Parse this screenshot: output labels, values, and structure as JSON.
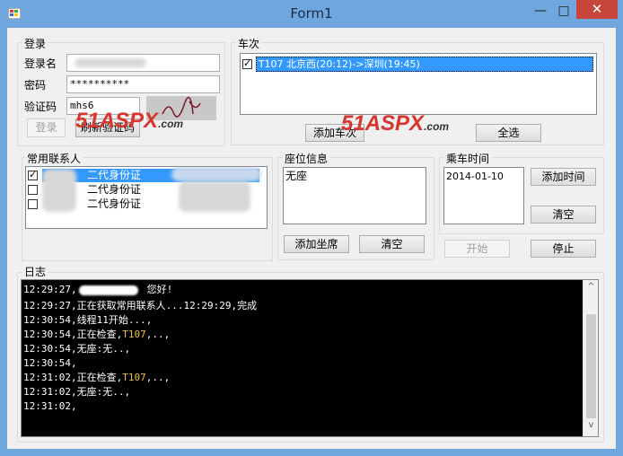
{
  "window": {
    "title": "Form1",
    "minimize_glyph": "—",
    "maximize_glyph": "□",
    "close_glyph": "✕"
  },
  "login": {
    "group_label": "登录",
    "username_label": "登录名",
    "password_label": "密码",
    "password_value": "**********",
    "captcha_label": "验证码",
    "captcha_value": "mhs6",
    "captcha_image_text": "mhs6",
    "login_button": "登录",
    "refresh_captcha_button": "刷新验证码"
  },
  "trains": {
    "group_label": "车次",
    "items": [
      {
        "checked": true,
        "text": "T107 北京西(20:12)->深圳(19:45)"
      }
    ],
    "add_button": "添加车次",
    "select_all_button": "全选"
  },
  "contacts": {
    "group_label": "常用联系人",
    "items": [
      {
        "checked": true,
        "id_type": "二代身份证",
        "selected": true
      },
      {
        "checked": false,
        "id_type": "二代身份证",
        "selected": false
      },
      {
        "checked": false,
        "id_type": "二代身份证",
        "selected": false
      }
    ]
  },
  "seats": {
    "group_label": "座位信息",
    "items": [
      "无座"
    ],
    "add_button": "添加坐席",
    "clear_button": "清空"
  },
  "travel_time": {
    "group_label": "乘车时间",
    "items": [
      "2014-01-10"
    ],
    "add_button": "添加时间",
    "clear_button": "清空"
  },
  "controls": {
    "start_button": "开始",
    "stop_button": "停止"
  },
  "log": {
    "group_label": "日志",
    "lines": [
      {
        "time": "12:29:27,",
        "text": "您好!"
      },
      {
        "time": "12:29:27,",
        "text": "正在获取常用联系人...12:29:29,完成"
      },
      {
        "time": "12:30:54,",
        "text": "线程11开始...,"
      },
      {
        "time": "12:30:54,",
        "text": "正在检查,",
        "highlight": "T107",
        "tail": ",..,"
      },
      {
        "time": "12:30:54,",
        "text": "无座:无..,"
      },
      {
        "time": "12:30:54,",
        "text": ""
      },
      {
        "time": "12:31:02,",
        "text": "正在检查,",
        "highlight": "T107",
        "tail": ",..,"
      },
      {
        "time": "12:31:02,",
        "text": "无座:无..,"
      },
      {
        "time": "12:31:02,",
        "text": ""
      }
    ],
    "scroll_up": "^",
    "scroll_down": "v"
  },
  "watermark": {
    "text": "51ASPX",
    "suffix": ".com"
  }
}
